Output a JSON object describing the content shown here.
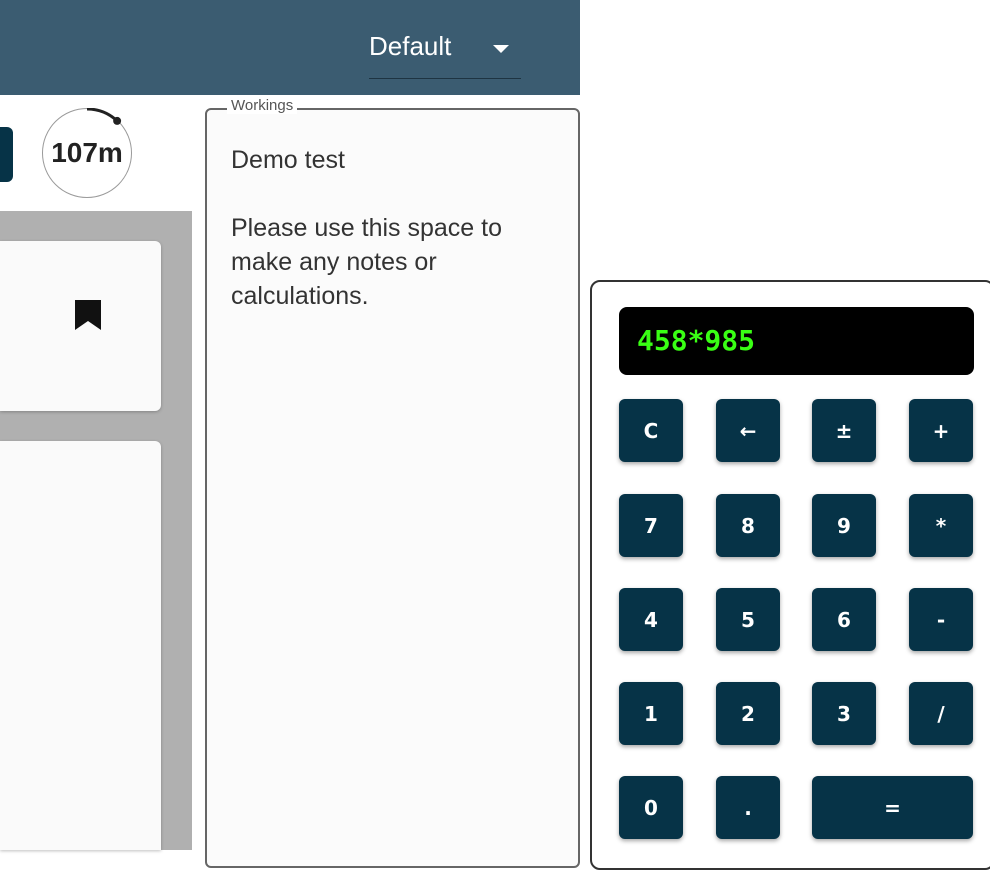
{
  "header": {
    "theme_select": {
      "value": "Default",
      "caret_icon": "caret-down-icon"
    }
  },
  "timer": {
    "text": "107m",
    "progress_fraction": 0.12
  },
  "sidebar": {
    "card_1": {
      "icon": "bookmark-icon"
    }
  },
  "workings": {
    "legend": "Workings",
    "text": "Demo test\n\nPlease use this space to make any notes or calculations."
  },
  "calculator": {
    "display": "458*985",
    "keys": {
      "clear": "C",
      "backspace": "←",
      "negate": "±",
      "add": "+",
      "seven": "7",
      "eight": "8",
      "nine": "9",
      "multiply": "*",
      "four": "4",
      "five": "5",
      "six": "6",
      "subtract": "-",
      "one": "1",
      "two": "2",
      "three": "3",
      "divide": "/",
      "zero": "0",
      "decimal": ".",
      "equals": "="
    }
  },
  "colors": {
    "header_bg": "#3b5c71",
    "key_bg": "#063347",
    "display_text": "#39ff14",
    "sidebar_gray": "#b0b0b0"
  }
}
